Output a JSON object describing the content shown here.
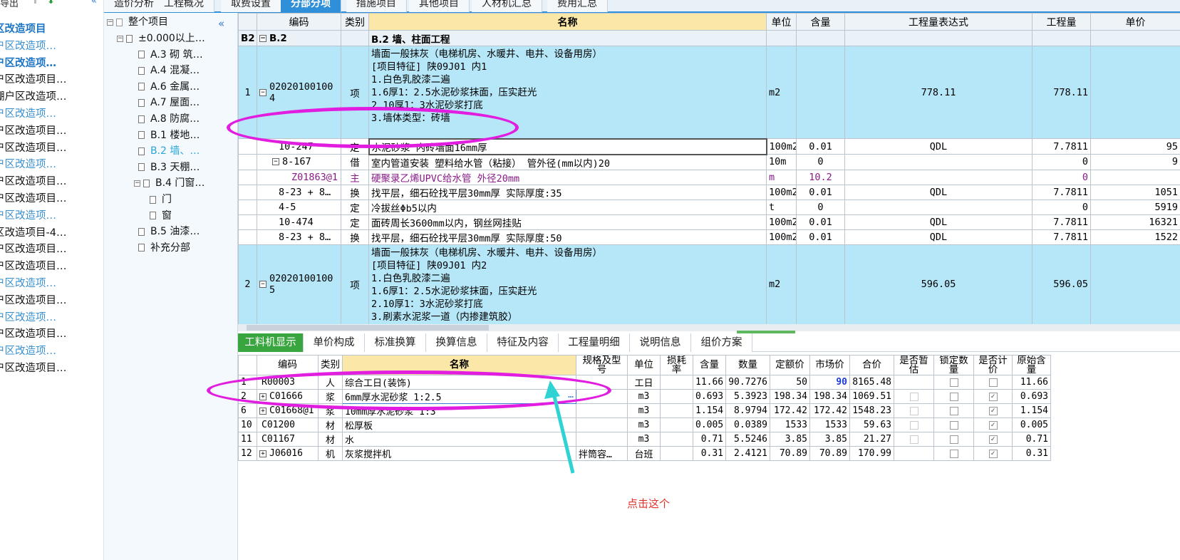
{
  "left_list": {
    "top_label": "导出",
    "items": [
      {
        "label": "区改造项目",
        "style": "sel"
      },
      {
        "label": "户区改造项…",
        "style": "blue"
      },
      {
        "label": "户区改造项…",
        "style": "sel"
      },
      {
        "label": "户区改造项目…",
        "style": "dark"
      },
      {
        "label": "棚户区改造项…",
        "style": "dark"
      },
      {
        "label": "户区改造项…",
        "style": "blue"
      },
      {
        "label": "户区改造项目…",
        "style": "dark"
      },
      {
        "label": "户区改造项目…",
        "style": "dark"
      },
      {
        "label": "户区改造项…",
        "style": "blue"
      },
      {
        "label": "户区改造项目…",
        "style": "dark"
      },
      {
        "label": "户区改造项目…",
        "style": "dark"
      },
      {
        "label": "户区改造项…",
        "style": "blue"
      },
      {
        "label": "区改造项目-4…",
        "style": "dark"
      },
      {
        "label": "户区改造项目…",
        "style": "dark"
      },
      {
        "label": "户区改造项目…",
        "style": "dark"
      },
      {
        "label": "户区改造项…",
        "style": "blue"
      },
      {
        "label": "户区改造项目…",
        "style": "dark"
      },
      {
        "label": "户区改造项…",
        "style": "blue"
      },
      {
        "label": "户区改造项目…",
        "style": "dark"
      },
      {
        "label": "户区改造项…",
        "style": "blue"
      },
      {
        "label": "户区改造项目…",
        "style": "dark"
      }
    ]
  },
  "top_tabs": [
    "造价分析",
    "工程概况",
    "取费设置",
    "分部分项",
    "措施项目",
    "其他项目",
    "人材机汇总",
    "费用汇总"
  ],
  "tree": {
    "root": "整个项目",
    "nodes": [
      {
        "label": "±0.000以上…",
        "level": 1,
        "toggle": "⊟"
      },
      {
        "label": "A.3 砌 筑…",
        "level": 2
      },
      {
        "label": "A.4 混凝…",
        "level": 2
      },
      {
        "label": "A.6 金属…",
        "level": 2
      },
      {
        "label": "A.7 屋面…",
        "level": 2
      },
      {
        "label": "A.8 防腐…",
        "level": 2
      },
      {
        "label": "B.1 楼地…",
        "level": 2
      },
      {
        "label": "B.2 墙、…",
        "level": 2,
        "selected": true
      },
      {
        "label": "B.3 天棚…",
        "level": 2
      },
      {
        "label": "B.4 门窗…",
        "level": 2,
        "toggle": "⊟"
      },
      {
        "label": "门",
        "level": 3
      },
      {
        "label": "窗",
        "level": 3
      },
      {
        "label": "B.5 油漆…",
        "level": 2
      },
      {
        "label": "补充分部",
        "level": 2
      }
    ]
  },
  "grid": {
    "headers": [
      "",
      "编码",
      "类别",
      "名称",
      "单位",
      "含量",
      "工程量表达式",
      "工程量",
      "单价"
    ],
    "section": {
      "idx": "B2",
      "code": "B.2",
      "name": "B.2  墙、柱面工程"
    },
    "item1": {
      "idx": "1",
      "code": "020201001004",
      "type": "项",
      "lines": [
        "墙面一般抹灰（电梯机房、水暖井、电井、设备用房）",
        "[项目特征]  陕09J01 内1",
        "1.白色乳胶漆二遍",
        "1.6厚1：2.5水泥砂浆抹面，压实赶光",
        "2.10厚1：3水泥砂浆打底",
        "3.墙体类型：砖墙"
      ],
      "unit": "m2",
      "expr": "778.11",
      "qty": "778.11"
    },
    "subrows": [
      {
        "code": "10-247",
        "type": "定",
        "name": "水泥砂浆 内砖墙面16mm厚",
        "unit": "100m2",
        "content": "0.01",
        "expr": "QDL",
        "qty": "7.7811",
        "price": "95"
      },
      {
        "code": "8-167",
        "type": "借",
        "name": "室内管道安装 塑料给水管（粘接） 管外径(mm以内)20",
        "unit": "10m",
        "content": "0",
        "expr": "",
        "qty": "0",
        "price": "9"
      },
      {
        "code": "Z01863@1",
        "type": "主",
        "name": "硬聚录乙烯UPVC给水管 外径20mm",
        "unit": "m",
        "content": "10.2",
        "expr": "",
        "qty": "0",
        "price": "",
        "purple": true
      },
      {
        "code": "8-23 + 8…",
        "type": "换",
        "name": "找平层，细石砼找平层30mm厚  实际厚度:35",
        "unit": "100m2",
        "content": "0.01",
        "expr": "QDL",
        "qty": "7.7811",
        "price": "1051"
      },
      {
        "code": "4-5",
        "type": "定",
        "name": "冷拔丝Φb5以内",
        "unit": "t",
        "content": "0",
        "expr": "",
        "qty": "0",
        "price": "5919"
      },
      {
        "code": "10-474",
        "type": "定",
        "name": "面砖周长3600mm以内，钢丝网挂贴",
        "unit": "100m2",
        "content": "0.01",
        "expr": "QDL",
        "qty": "7.7811",
        "price": "16321"
      },
      {
        "code": "8-23 + 8…",
        "type": "换",
        "name": "找平层，细石砼找平层30mm厚  实际厚度:50",
        "unit": "100m2",
        "content": "0.01",
        "expr": "QDL",
        "qty": "7.7811",
        "price": "1522"
      }
    ],
    "item2": {
      "idx": "2",
      "code": "020201001005",
      "type": "项",
      "lines": [
        "墙面一般抹灰（电梯机房、水暖井、电井、设备用房）",
        "[项目特征]  陕09J01 内2",
        "1.白色乳胶漆二遍",
        "1.6厚1：2.5水泥砂浆抹面，压实赶光",
        "2.10厚1：3水泥砂浆打底",
        "3.刷素水泥浆一道（内掺建筑胶）"
      ],
      "unit": "m2",
      "expr": "596.05",
      "qty": "596.05"
    }
  },
  "bottom_tabs": [
    "工料机显示",
    "单价构成",
    "标准换算",
    "换算信息",
    "特征及内容",
    "工程量明细",
    "说明信息",
    "组价方案"
  ],
  "bottom_grid": {
    "headers": [
      "",
      "编码",
      "类别",
      "名称",
      "规格及型号",
      "单位",
      "损耗率",
      "含量",
      "数量",
      "定额价",
      "市场价",
      "合价",
      "是否暂估",
      "锁定数量",
      "是否计价",
      "原始含量"
    ],
    "rows": [
      {
        "idx": "1",
        "code": "R00003",
        "type": "人",
        "name": "综合工日(装饰)",
        "spec": "",
        "unit": "工日",
        "loss": "",
        "content": "11.66",
        "qty": "90.7276",
        "base": "50",
        "market": "90",
        "total": "8165.48",
        "est": "",
        "lock": "",
        "priced": "",
        "orig": "11.66",
        "tree": false,
        "market_blue": true,
        "est_box": false
      },
      {
        "idx": "2",
        "code": "C01666",
        "type": "浆",
        "name": "6mm厚水泥砂浆 1:2.5",
        "spec": "",
        "unit": "m3",
        "loss": "",
        "content": "0.693",
        "qty": "5.3923",
        "base": "198.34",
        "market": "198.34",
        "total": "1069.51",
        "est": "",
        "lock": "",
        "priced": "✓",
        "orig": "0.693",
        "tree": true,
        "est_box": true
      },
      {
        "idx": "6",
        "code": "C01668@1",
        "type": "浆",
        "name": "10mm厚水泥砂浆 1:3",
        "spec": "",
        "unit": "m3",
        "loss": "",
        "content": "1.154",
        "qty": "8.9794",
        "base": "172.42",
        "market": "172.42",
        "total": "1548.23",
        "est": "",
        "lock": "",
        "priced": "✓",
        "orig": "1.154",
        "tree": true,
        "est_box": true
      },
      {
        "idx": "10",
        "code": "C01200",
        "type": "材",
        "name": "松厚板",
        "spec": "",
        "unit": "m3",
        "loss": "",
        "content": "0.005",
        "qty": "0.0389",
        "base": "1533",
        "market": "1533",
        "total": "59.63",
        "est": "",
        "lock": "",
        "priced": "✓",
        "orig": "0.005",
        "tree": false,
        "est_box": true
      },
      {
        "idx": "11",
        "code": "C01167",
        "type": "材",
        "name": "水",
        "spec": "",
        "unit": "m3",
        "loss": "",
        "content": "0.71",
        "qty": "5.5246",
        "base": "3.85",
        "market": "3.85",
        "total": "21.27",
        "est": "",
        "lock": "",
        "priced": "✓",
        "orig": "0.71",
        "tree": false,
        "est_box": true
      },
      {
        "idx": "12",
        "code": "J06016",
        "type": "机",
        "name": "灰浆搅拌机",
        "spec": "拌筒容…",
        "unit": "台班",
        "loss": "",
        "content": "0.31",
        "qty": "2.4121",
        "base": "70.89",
        "market": "70.89",
        "total": "170.99",
        "est": "",
        "lock": "",
        "priced": "✓",
        "orig": "0.31",
        "tree": true,
        "est_box": false
      }
    ],
    "ellipsis": "…"
  },
  "annotation": {
    "note": "点击这个",
    "ellipse_color": "#e11ee0",
    "arrow_color": "#2fd3d3"
  },
  "colors": {
    "accent": "#2f8fd8",
    "item_row": "#b6e7f8",
    "active_bottom_tab": "#39a53f",
    "header_name": "#fbe7a8"
  }
}
